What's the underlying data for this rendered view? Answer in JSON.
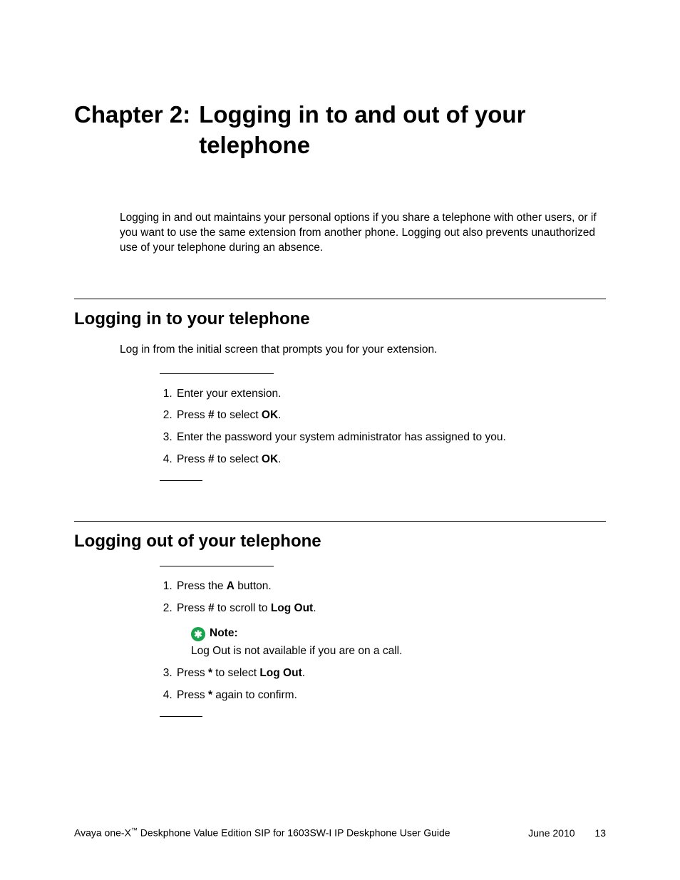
{
  "chapter": {
    "label": "Chapter 2:",
    "title": "Logging in to and out of your telephone"
  },
  "intro": "Logging in and out maintains your personal options if you share a telephone with other users, or if you want to use the same extension from another phone. Logging out also prevents unauthorized use of your telephone during an absence.",
  "section1": {
    "heading": "Logging in to your telephone",
    "lead": "Log in from the initial screen that prompts you for your extension.",
    "steps": {
      "s1": "Enter your extension.",
      "s2a": "Press ",
      "s2b": "#",
      "s2c": " to select ",
      "s2d": "OK",
      "s2e": ".",
      "s3": "Enter the password your system administrator has assigned to you.",
      "s4a": "Press ",
      "s4b": "#",
      "s4c": " to select ",
      "s4d": "OK",
      "s4e": "."
    }
  },
  "section2": {
    "heading": "Logging out of your telephone",
    "steps": {
      "s1a": "Press the ",
      "s1b": "A",
      "s1c": " button.",
      "s2a": "Press ",
      "s2b": "#",
      "s2c": " to scroll to ",
      "s2d": "Log Out",
      "s2e": ".",
      "note_label": "Note:",
      "note_body": "Log Out is not available if you are on a call.",
      "s3a": "Press ",
      "s3b": "*",
      "s3c": " to select ",
      "s3d": "Log Out",
      "s3e": ".",
      "s4a": "Press ",
      "s4b": "*",
      "s4c": " again to confirm."
    }
  },
  "footer": {
    "product_a": "Avaya one-X",
    "tm": "™",
    "product_b": " Deskphone Value Edition SIP for 1603SW-I IP Deskphone User Guide",
    "date": "June 2010",
    "page": "13"
  }
}
